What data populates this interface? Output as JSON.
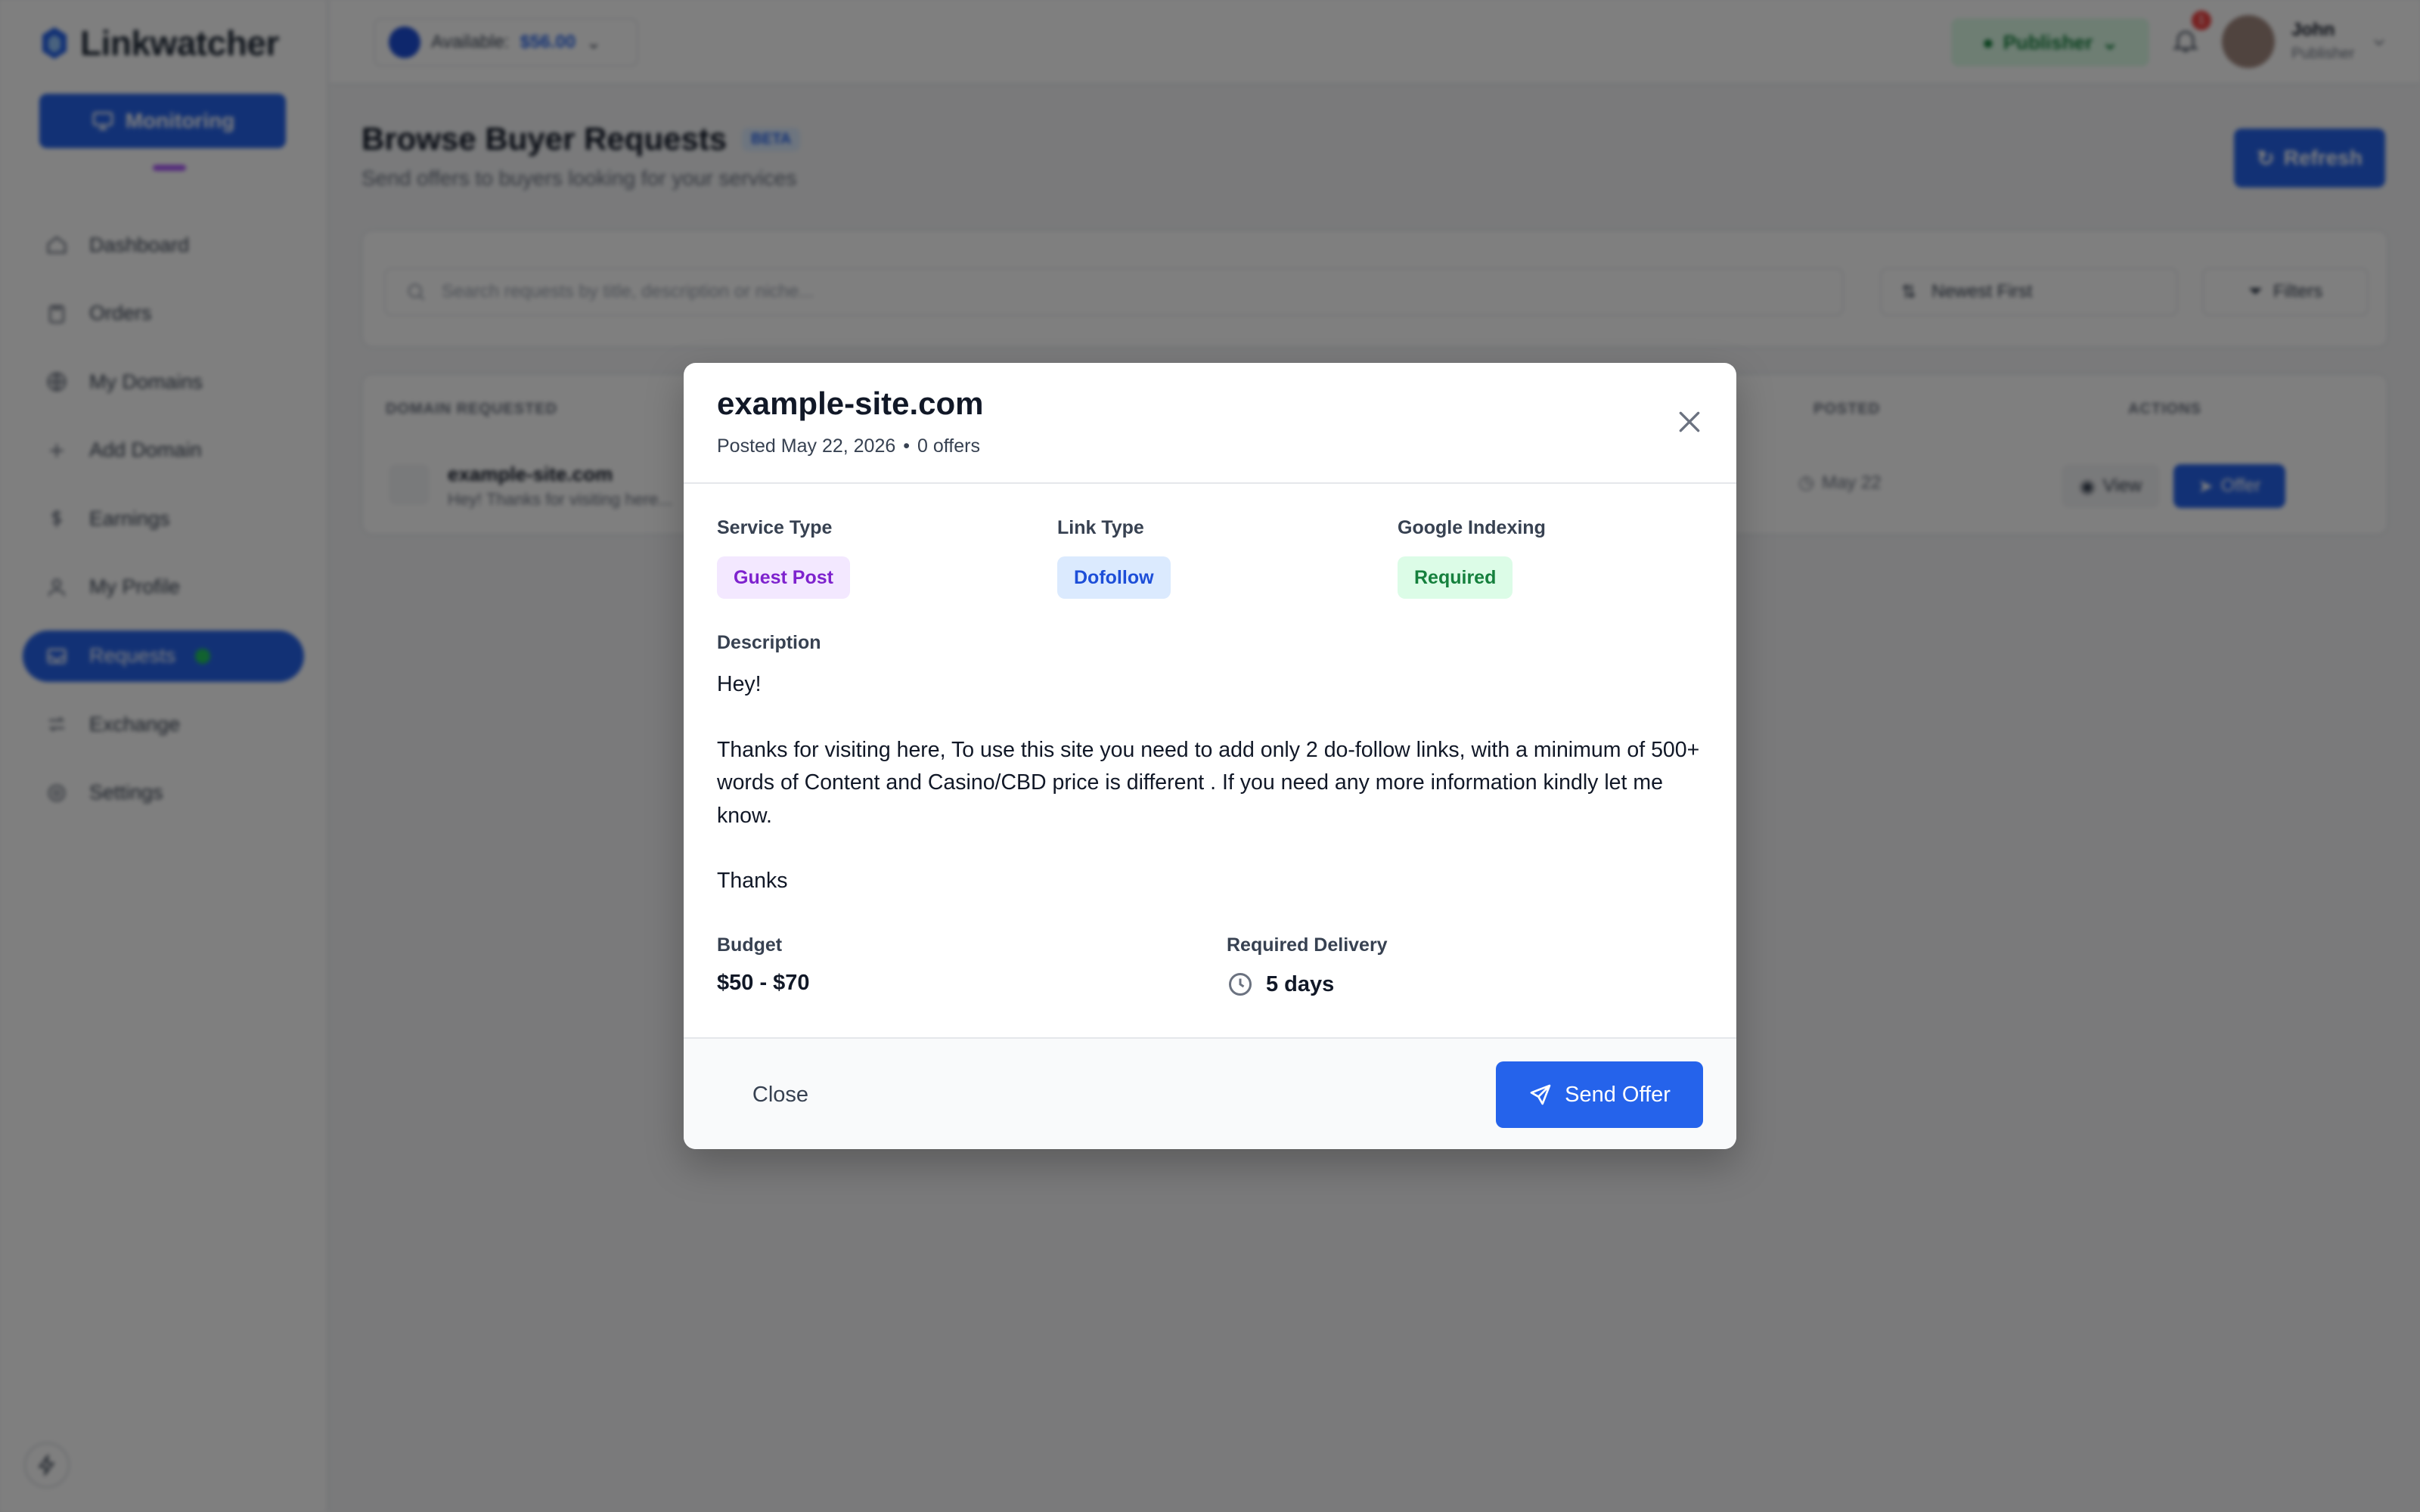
{
  "app": {
    "name": "Linkwatcher"
  },
  "sidebar": {
    "monitor_label": "Monitoring",
    "items": [
      {
        "label": "Dashboard",
        "icon": "home-icon"
      },
      {
        "label": "Orders",
        "icon": "clipboard-icon"
      },
      {
        "label": "My Domains",
        "icon": "globe-icon"
      },
      {
        "label": "Add Domain",
        "icon": "plus-icon"
      },
      {
        "label": "Earnings",
        "icon": "dollar-icon"
      },
      {
        "label": "My Profile",
        "icon": "user-icon"
      },
      {
        "label": "Requests",
        "icon": "inbox-icon",
        "active": true
      },
      {
        "label": "Exchange",
        "icon": "exchange-icon"
      },
      {
        "label": "Settings",
        "icon": "gear-icon"
      }
    ]
  },
  "topbar": {
    "available_label": "Available:",
    "available_amount": "$56.00",
    "publisher_label": "Publisher",
    "notification_count": "1",
    "user_name": "John",
    "user_role": "Publisher"
  },
  "page": {
    "title": "Browse Buyer Requests",
    "beta": "BETA",
    "subtitle": "Send offers to buyers looking for your services",
    "refresh_label": "Refresh"
  },
  "filters": {
    "search_placeholder": "Search requests by title, description or niche...",
    "sort_value": "Newest First",
    "filters_label": "Filters"
  },
  "table": {
    "headers": {
      "domain": "DOMAIN REQUESTED",
      "posted": "POSTED",
      "actions": "ACTIONS"
    },
    "row": {
      "domain": "example-site.com",
      "desc": "Hey! Thanks for visiting here...",
      "date": "May 22",
      "view_label": "View",
      "offer_label": "Offer"
    }
  },
  "modal": {
    "title": "example-site.com",
    "posted": "Posted May 22, 2026",
    "sep": "•",
    "offers": "0 offers",
    "service_type_label": "Service Type",
    "service_type_value": "Guest Post",
    "link_type_label": "Link Type",
    "link_type_value": "Dofollow",
    "indexing_label": "Google Indexing",
    "indexing_value": "Required",
    "description_label": "Description",
    "description": {
      "line1": "Hey!",
      "line2": "Thanks for visiting here, To use this site you need to add only 2 do-follow links, with a minimum of 500+ words of Content and Casino/CBD price is different . If you need any more information kindly let me know.",
      "line3": "Thanks"
    },
    "budget_label": "Budget",
    "budget_value": "$50 - $70",
    "delivery_label": "Required Delivery",
    "delivery_value": "5 days",
    "close_label": "Close",
    "send_label": "Send Offer"
  },
  "colors": {
    "primary": "#2563eb",
    "purple_tag": "#7e22ce",
    "green_tag": "#15803d"
  }
}
